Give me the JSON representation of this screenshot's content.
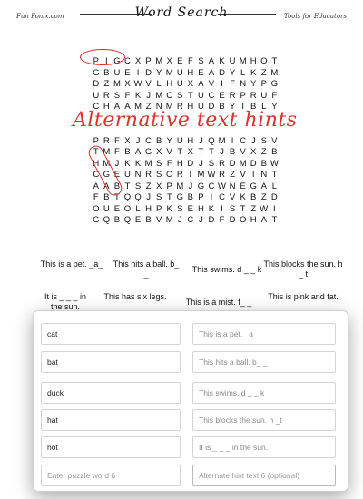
{
  "header": {
    "left": "Fun Fonix.com",
    "title": "Word Search",
    "right": "Tools for Educators"
  },
  "grid": [
    "PIGCXPMXEFSAKUMHOT",
    "GBUEIDYMUHEADYLKZM",
    "DZMXWVLHUXAVIFNYPG",
    "URSFKJMCSTUCERPRUF",
    "CHAAMZNMRHUDBYIBLY",
    "",
    "",
    "PRFXJCBYUHJQMICJSV",
    "TMFBAGXVTXTTJBVXZB",
    "HMJKKMSFHDJSRDMDBW",
    "CGEUNRSORIMWRZVINT",
    "AABTSZXPMJGCWNEGAL",
    "FBTQQJSTGBPICVKBZD",
    "OUEOLHPKSEHKISTZWI",
    "GQBQEBVMJCJDFDOHAT"
  ],
  "overlay_title": "Alternative text hints",
  "hints_row1": [
    "This is a pet. _a_",
    "This hits a ball. b_ _",
    "This swims. d _ _ k",
    "This blocks the sun. h _ t"
  ],
  "hints_row2": [
    "It is _ _ _ in the sun.",
    "This has six legs.",
    "This is a mist. f_ _",
    "This is pink and fat."
  ],
  "inputs": [
    {
      "word": "cat",
      "hint": "This is a pet. _a_"
    },
    {
      "word": "bat",
      "hint": "This hits a ball. b_ _"
    },
    {
      "word": "duck",
      "hint": "This swims. d _ _ k"
    },
    {
      "word": "hat",
      "hint": "This blocks the sun. h _t"
    },
    {
      "word": "hot",
      "hint": "It is _ _ _ in the sun."
    }
  ],
  "placeholders": {
    "word": "Enter puzzle word 6",
    "hint": "Alternate hint text 6 (optional)"
  }
}
